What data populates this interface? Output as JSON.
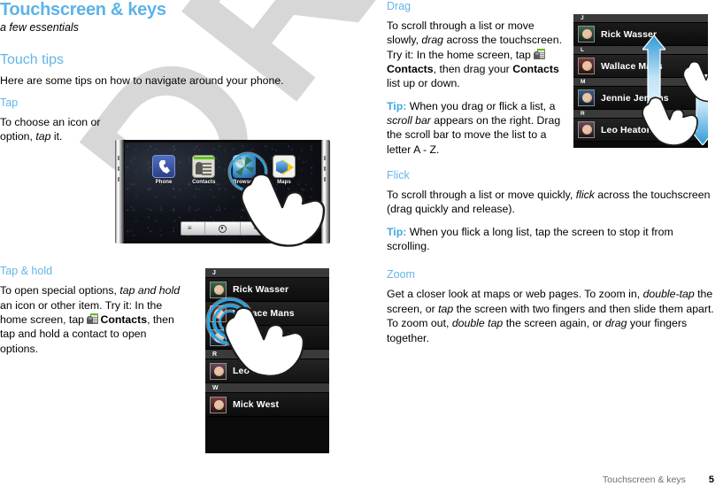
{
  "document": {
    "title": "Touchscreen & keys",
    "subtitle": "a few essentials",
    "footer_text": "Touchscreen & keys",
    "page_number": "5",
    "watermark": "DRAFT"
  },
  "colors": {
    "heading_blue": "#63b5e8",
    "title_blue": "#5cb3e8",
    "tip_blue": "#3fa9e0",
    "highlight_ring": "#21a7e8",
    "arrow_blue": "#7fc8ee",
    "watermark_gray": "#d7d7d7"
  },
  "left_column": {
    "section_heading": "Touch tips",
    "section_intro": "Here are some tips on how to navigate around your phone.",
    "tap": {
      "heading": "Tap",
      "body_1": "To choose an icon or option, ",
      "body_italic": "tap",
      "body_2": " it."
    },
    "tap_hold": {
      "heading": "Tap & hold",
      "t1": "To open special options, ",
      "t2_italic": "tap and hold",
      "t3": " an icon or other item. Try it: In the home screen, tap ",
      "t4_bold": "Contacts",
      "t5": ", then tap and hold a contact to open options."
    }
  },
  "right_column": {
    "drag": {
      "heading": "Drag",
      "t1": "To scroll through a list or move slowly, ",
      "t2_italic": "drag",
      "t3": " across the touchscreen. Try it: In the home screen, tap ",
      "t4_bold": "Contacts",
      "t5": ", then drag your ",
      "t6_bold": "Contacts",
      "t7": " list up or down.",
      "tip_label": "Tip:",
      "tip_1": " When you drag or flick a list, a ",
      "tip_2_italic": "scroll bar",
      "tip_3": " appears on the right. Drag the scroll bar to move the list to a letter A - Z."
    },
    "flick": {
      "heading": "Flick",
      "t1": "To scroll through a list or move quickly, ",
      "t2_italic": "flick",
      "t3": " across the touchscreen (drag quickly and release).",
      "tip_label": "Tip:",
      "tip_1": " When you flick a long list, tap the screen to stop it from scrolling."
    },
    "zoom": {
      "heading": "Zoom",
      "t1": "Get a closer look at maps or web pages. To zoom in, ",
      "t2_italic": "double-tap",
      "t3": " the screen, or ",
      "t4_italic": "tap",
      "t5": " the screen with two fingers and then slide them apart. To zoom out, ",
      "t6_italic": "double tap",
      "t7": " the screen again, or ",
      "t8_italic": "drag",
      "t9": " your fingers together."
    }
  },
  "figures": {
    "home_screen": {
      "apps": [
        {
          "label": "Phone",
          "icon": "phone-icon"
        },
        {
          "label": "Contacts",
          "icon": "contacts-icon"
        },
        {
          "label": "Browser",
          "icon": "browser-globe-icon"
        },
        {
          "label": "Maps",
          "icon": "maps-icon"
        }
      ],
      "softkeys": [
        {
          "icon": "menu-icon",
          "label": "≡"
        },
        {
          "icon": "home-icon",
          "label": ""
        },
        {
          "icon": "back-icon",
          "label": "≡"
        }
      ],
      "highlighted_app": "Browser"
    },
    "contacts_hold": {
      "items": [
        {
          "type": "header",
          "label": "J"
        },
        {
          "type": "contact",
          "name": "Rick Wasser"
        },
        {
          "type": "contact",
          "name": "Wallace Mans"
        },
        {
          "type": "contact",
          "name": "Jennie Jenkins"
        },
        {
          "type": "header",
          "label": "R"
        },
        {
          "type": "contact",
          "name": "Leo Heaton"
        },
        {
          "type": "header",
          "label": "W"
        },
        {
          "type": "contact",
          "name": "Mick West"
        }
      ],
      "highlighted_contact": "Wallace Mans"
    },
    "contacts_drag": {
      "items": [
        {
          "type": "header",
          "label": "J"
        },
        {
          "type": "contact",
          "name": "Rick Wasser"
        },
        {
          "type": "header",
          "label": "L"
        },
        {
          "type": "contact",
          "name": "Wallace Mans"
        },
        {
          "type": "header",
          "label": "M"
        },
        {
          "type": "contact",
          "name": "Jennie Jenkins"
        },
        {
          "type": "header",
          "label": "R"
        },
        {
          "type": "contact",
          "name": "Leo Heaton"
        }
      ]
    }
  }
}
